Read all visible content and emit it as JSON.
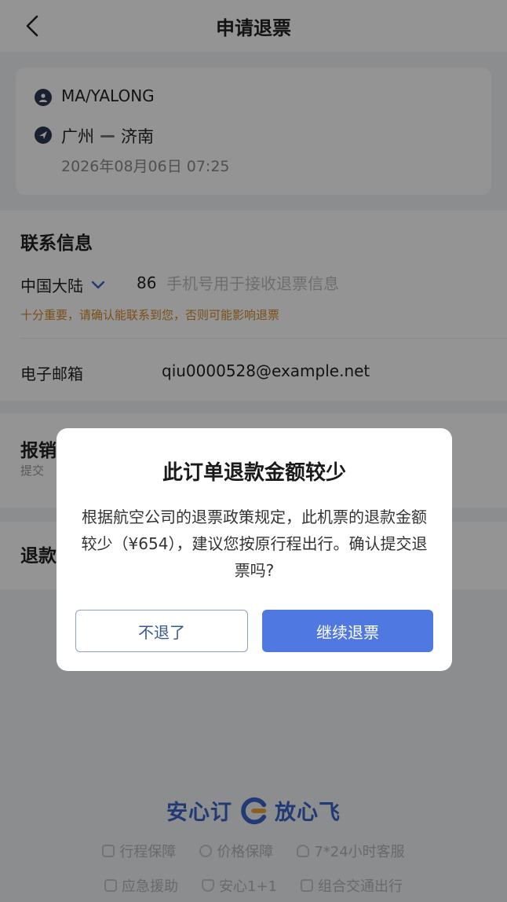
{
  "nav": {
    "title": "申请退票"
  },
  "trip": {
    "passenger": "MA/YALONG",
    "from": "广州",
    "to": "济南",
    "datetime": "2026年08月06日  07:25"
  },
  "contact": {
    "section_title": "联系信息",
    "region": "中国大陆",
    "area_code": "86",
    "phone_placeholder": "手机号用于接收退票信息",
    "warning": "十分重要，请确认能联系到您，否则可能影响退票",
    "email_label": "电子邮箱",
    "email_value": "qiu0000528@example.net"
  },
  "reimbursement": {
    "section_title": "报销",
    "subtitle": "提交"
  },
  "refund": {
    "section_title": "退款"
  },
  "footer": {
    "brand_left": "安心订",
    "brand_right": "放心飞",
    "row1": [
      "行程保障",
      "价格保障",
      "7*24小时客服"
    ],
    "row2": [
      "应急援助",
      "安心1+1",
      "组合交通出行"
    ]
  },
  "dialog": {
    "title": "此订单退款金额较少",
    "body": "根据航空公司的退票政策规定，此机票的退款金额较少（¥654），建议您按原行程出行。确认提交退票吗?",
    "cancel_label": "不退了",
    "confirm_label": "继续退票"
  },
  "colors": {
    "primary": "#4f79e0",
    "warning": "#d48a2a",
    "brand": "#3a63c8"
  }
}
